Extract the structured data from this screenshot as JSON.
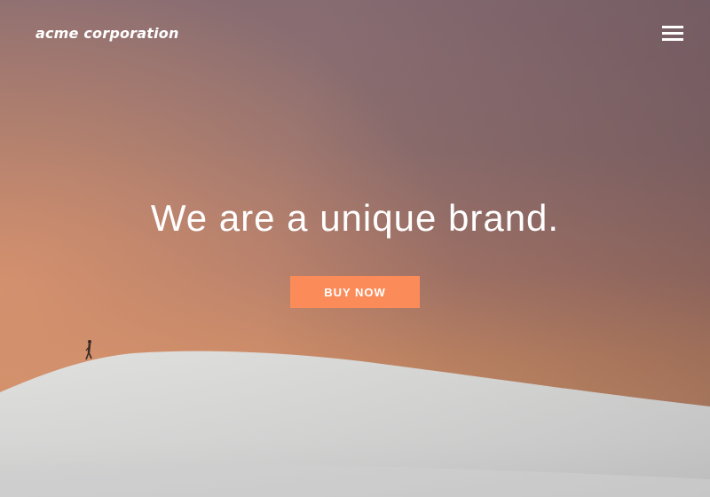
{
  "header": {
    "logo_text": "acme corporation",
    "menu_icon": "hamburger-menu-icon"
  },
  "hero": {
    "headline": "We are a unique brand.",
    "cta_label": "BUY NOW"
  },
  "colors": {
    "cta_background": "#fb8c5a",
    "text": "#ffffff",
    "sky_top": "#876c72",
    "sky_horizon": "#cf9169",
    "dune": "#d6d6d4"
  }
}
